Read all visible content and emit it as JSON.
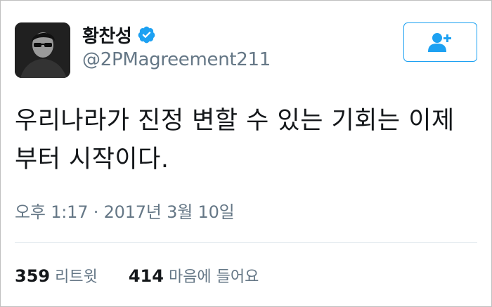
{
  "user": {
    "display_name": "황찬성",
    "handle": "@2PMagreement211",
    "verified_icon": "verified-badge-icon",
    "avatar_icon": "profile-avatar-photo"
  },
  "follow_button": {
    "icon": "add-user-icon"
  },
  "tweet": {
    "text": "우리나라가 진정 변할 수 있는 기회는 이제\n부터 시작이다.",
    "timestamp": "오후 1:17 · 2017년 3월 10일"
  },
  "stats": {
    "retweets_count": "359",
    "retweets_label": "리트윗",
    "likes_count": "414",
    "likes_label": "마음에 들어요"
  },
  "colors": {
    "accent": "#1da1f2",
    "secondary_text": "#657786",
    "primary_text": "#14171a"
  }
}
